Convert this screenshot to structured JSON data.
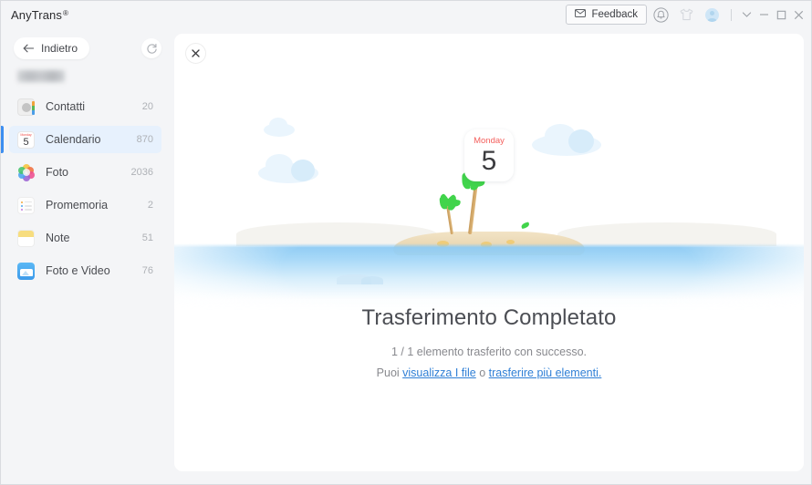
{
  "window": {
    "app_title": "AnyTrans",
    "registered_mark": "®",
    "controls": {
      "feedback_label": "Feedback",
      "feedback_icon": "envelope-icon",
      "bell_icon": "bell-icon",
      "tshirt_icon": "tshirt-icon",
      "avatar_icon": "user-avatar-icon",
      "chevron_down_icon": "chevron-down-icon",
      "minimize_icon": "minimize-icon",
      "maximize_icon": "maximize-icon",
      "close_icon": "close-icon"
    }
  },
  "sidebar": {
    "back_label": "Indietro",
    "back_icon": "arrow-left-icon",
    "refresh_icon": "refresh-icon",
    "device_name": "",
    "items": [
      {
        "label": "Contatti",
        "count": "20",
        "icon": "contacts-icon",
        "selected": false
      },
      {
        "label": "Calendario",
        "count": "870",
        "icon": "calendar-icon",
        "selected": true
      },
      {
        "label": "Foto",
        "count": "2036",
        "icon": "photos-icon",
        "selected": false
      },
      {
        "label": "Promemoria",
        "count": "2",
        "icon": "reminders-icon",
        "selected": false
      },
      {
        "label": "Note",
        "count": "51",
        "icon": "notes-icon",
        "selected": false
      },
      {
        "label": "Foto e Video",
        "count": "76",
        "icon": "photos-videos-icon",
        "selected": false
      }
    ]
  },
  "content": {
    "close_icon": "close-icon",
    "illustration": {
      "name": "island-calendar-illustration",
      "calendar_card": {
        "day_label": "Monday",
        "day_number": "5"
      }
    },
    "headline": "Trasferimento Completato",
    "subline": "1 / 1 elemento trasferito con successo.",
    "link_prefix": "Puoi ",
    "link_view_files": "visualizza I file",
    "link_separator": " o ",
    "link_transfer_more": "trasferire più elementi."
  },
  "colors": {
    "accent_blue": "#3d8ef0",
    "link_blue": "#2f7fd6",
    "selected_row_bg": "#e7f1fd",
    "window_bg": "#f4f5f7",
    "panel_bg": "#ffffff",
    "sea_blue": "#8dcbf4",
    "palm_green": "#41d44b",
    "sand_tan": "#e4d0a8",
    "calendar_red": "#f4605d",
    "notes_yellow": "#f7dd7f"
  }
}
